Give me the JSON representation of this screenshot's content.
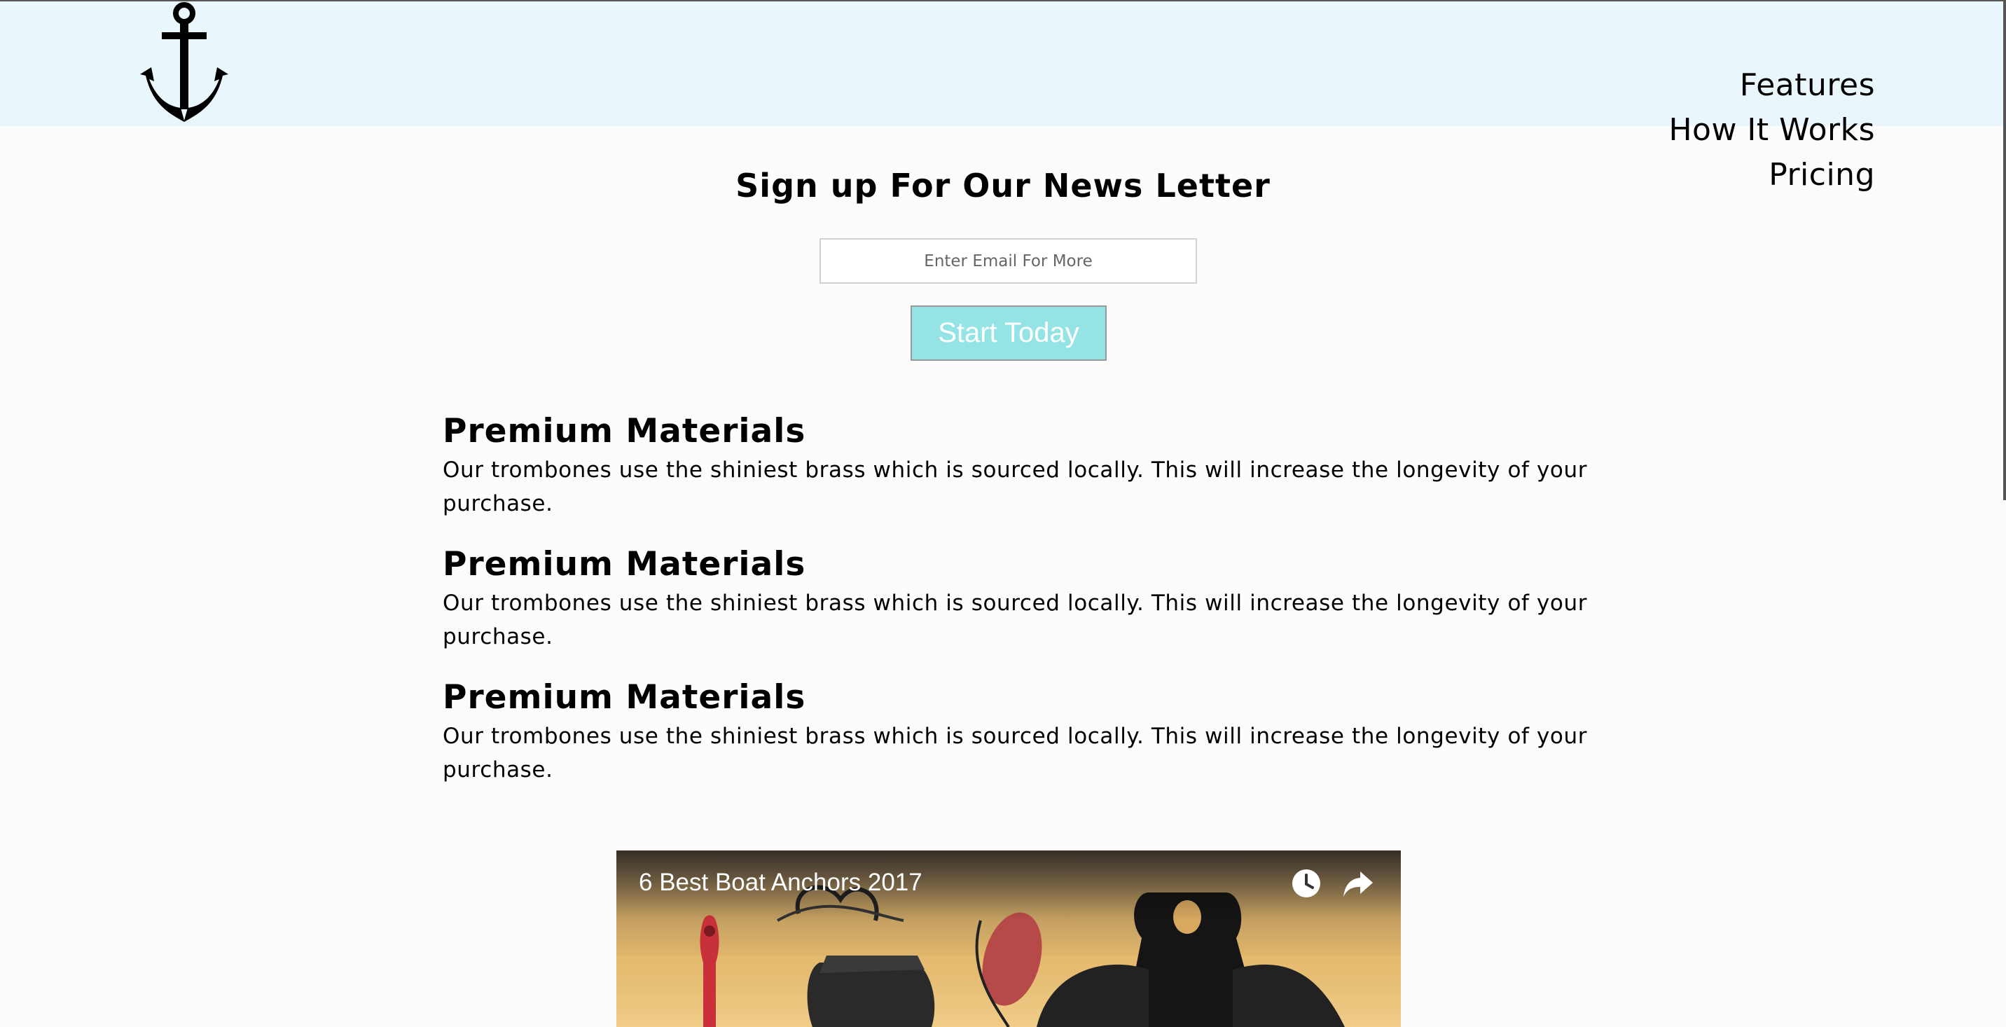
{
  "header": {
    "logo": "anchor-icon",
    "nav": [
      "Features",
      "How It Works",
      "Pricing"
    ]
  },
  "signup": {
    "title": "Sign up For Our News Letter",
    "email_placeholder": "Enter Email For More",
    "button_label": "Start Today"
  },
  "features": [
    {
      "title": "Premium Materials",
      "text": "Our trombones use the shiniest brass which is sourced locally. This will increase the longevity of your purchase."
    },
    {
      "title": "Premium Materials",
      "text": "Our trombones use the shiniest brass which is sourced locally. This will increase the longevity of your purchase."
    },
    {
      "title": "Premium Materials",
      "text": "Our trombones use the shiniest brass which is sourced locally. This will increase the longevity of your purchase."
    }
  ],
  "video": {
    "title": "6 Best Boat Anchors 2017",
    "icons": [
      "watch-later-icon",
      "share-icon"
    ]
  },
  "colors": {
    "header_bg": "#e9f7fd",
    "button_bg": "#94e4e6",
    "page_bg": "#fcfcfc"
  }
}
